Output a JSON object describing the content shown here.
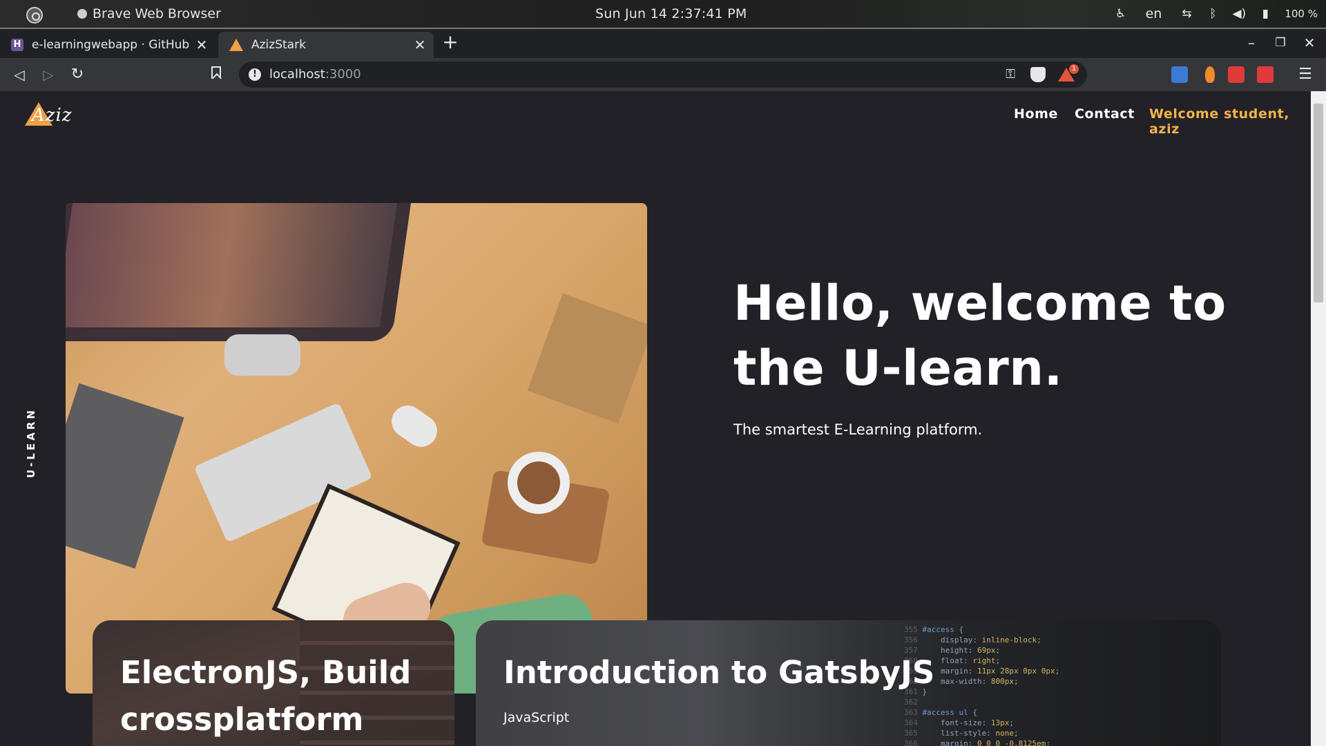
{
  "os_bar": {
    "app_name": "Brave Web Browser",
    "datetime": "Sun Jun 14   2:37:41 PM",
    "language": "en",
    "battery": "100 %"
  },
  "browser": {
    "tabs": [
      {
        "title": "e-learningwebapp · GitHub | H",
        "active": false
      },
      {
        "title": "AzizStark",
        "active": true
      }
    ],
    "new_tab_symbol": "+",
    "close_symbol": "✕",
    "url_host": "localhost",
    "url_port": ":3000"
  },
  "site": {
    "logo_text": "Aziz",
    "nav": {
      "home": "Home",
      "contact": "Contact",
      "welcome": "Welcome student, aziz"
    },
    "side_label": "U-LEARN",
    "hero": {
      "title": "Hello, welcome to the U-learn.",
      "subtitle": "The smartest E-Learning platform."
    },
    "courses": [
      {
        "title": "ElectronJS, Build crossplatform",
        "tag": ""
      },
      {
        "title": "Introduction to GatsbyJS",
        "tag": "JavaScript"
      }
    ]
  },
  "colors": {
    "page_bg": "#222127",
    "accent": "#f5b34a",
    "logo_triangle": "#f0a046"
  },
  "icons": [
    "activities-icon",
    "accessibility-icon",
    "network-icon",
    "bluetooth-icon",
    "volume-icon",
    "battery-icon",
    "github-favicon",
    "azizstark-favicon",
    "back-icon",
    "forward-icon",
    "reload-icon",
    "bookmark-icon",
    "info-icon",
    "key-icon",
    "brave-shields-icon",
    "brave-rewards-icon",
    "translate-icon",
    "menu-icon"
  ]
}
